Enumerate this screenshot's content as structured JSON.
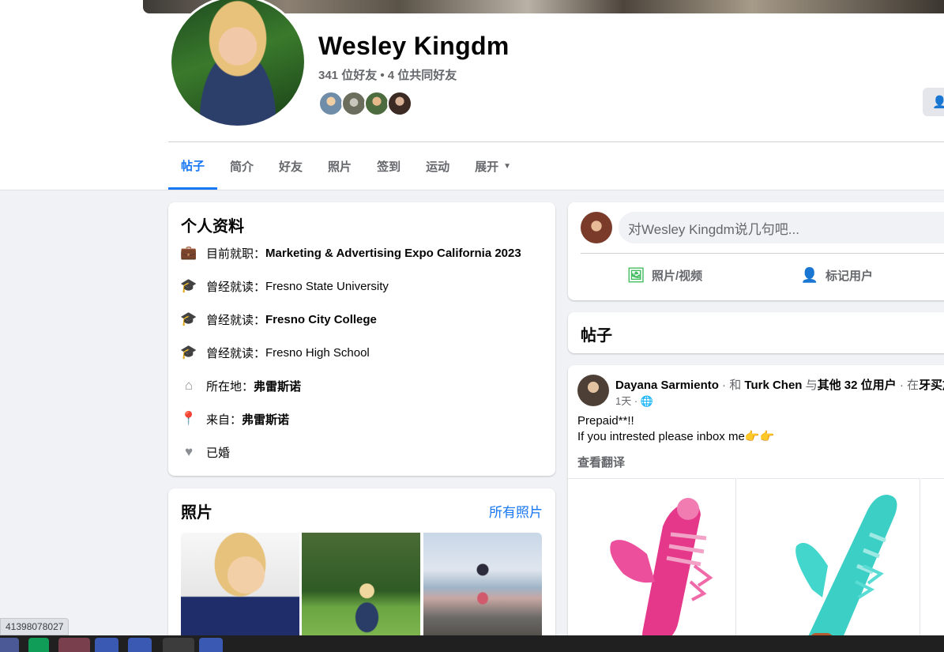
{
  "profile": {
    "name": "Wesley Kingdm",
    "friends_summary": "341 位好友 • 4 位共同好友"
  },
  "tabs": [
    {
      "label": "帖子"
    },
    {
      "label": "简介"
    },
    {
      "label": "好友"
    },
    {
      "label": "照片"
    },
    {
      "label": "签到"
    },
    {
      "label": "运动"
    },
    {
      "label": "展开"
    }
  ],
  "intro": {
    "title": "个人资料",
    "rows": [
      {
        "icon": "briefcase-icon",
        "prefix": "目前就职：",
        "value": "Marketing & Advertising Expo California 2023",
        "value_bold": true
      },
      {
        "icon": "graduation-cap-icon",
        "prefix": "曾经就读：",
        "value": "Fresno State University",
        "value_bold": false
      },
      {
        "icon": "graduation-cap-icon",
        "prefix": "曾经就读：",
        "value": "Fresno City College",
        "value_bold": true
      },
      {
        "icon": "graduation-cap-icon",
        "prefix": "曾经就读：",
        "value": "Fresno High School",
        "value_bold": false
      },
      {
        "icon": "home-icon",
        "prefix": "所在地：",
        "value": "弗雷斯诺",
        "value_bold": true
      },
      {
        "icon": "location-pin-icon",
        "prefix": "来自：",
        "value": "弗雷斯诺",
        "value_bold": true
      },
      {
        "icon": "heart-icon",
        "prefix": "",
        "value": "已婚",
        "value_bold": false
      }
    ]
  },
  "photos": {
    "title": "照片",
    "all_link": "所有照片"
  },
  "composer": {
    "placeholder": "对Wesley Kingdm说几句吧...",
    "photo_video": "照片/视频",
    "tag_people": "标记用户"
  },
  "posts": {
    "title": "帖子",
    "first": {
      "author": "Dayana Sarmiento",
      "sep1": " · 和 ",
      "with": "Turk Chen",
      "sep2": " 与",
      "others": "其他 32 位用户",
      "sep3": " · 在",
      "place": "牙买加",
      "time": "1天 · ",
      "privacy_icon": "globe-icon",
      "text_line1": "Prepaid**!!",
      "text_line2": "If you intrested please inbox me👉👉",
      "translate": "查看翻译"
    }
  },
  "statusbar": {
    "url_fragment": "41398078027"
  },
  "colors": {
    "accent": "#1877f2",
    "background": "#f0f2f5",
    "secondary_text": "#65676b"
  }
}
